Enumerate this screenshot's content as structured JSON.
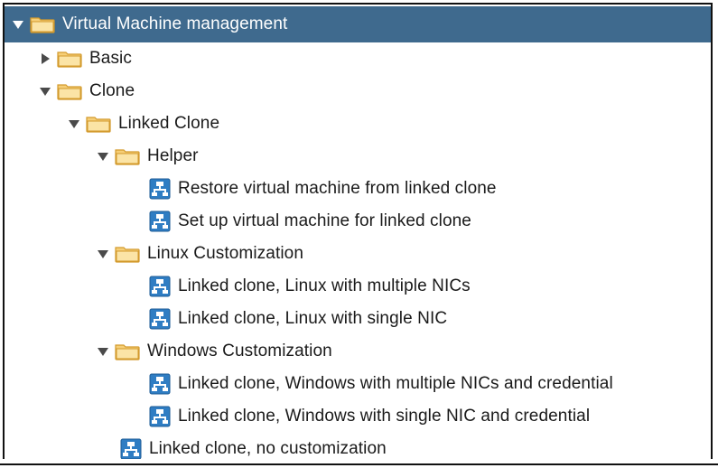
{
  "tree": {
    "root": {
      "label": "Virtual Machine management",
      "expanded": true
    },
    "basic": {
      "label": "Basic",
      "expanded": false
    },
    "clone": {
      "label": "Clone",
      "expanded": true
    },
    "linked_clone": {
      "label": "Linked Clone",
      "expanded": true
    },
    "helper": {
      "label": "Helper",
      "expanded": true
    },
    "restore": {
      "label": "Restore virtual machine from linked clone"
    },
    "setup": {
      "label": "Set up virtual machine for linked clone"
    },
    "linux_custom": {
      "label": "Linux Customization",
      "expanded": true
    },
    "linux_multi": {
      "label": "Linked clone, Linux with multiple NICs"
    },
    "linux_single": {
      "label": "Linked clone, Linux with single NIC"
    },
    "windows_custom": {
      "label": "Windows Customization",
      "expanded": true
    },
    "windows_multi": {
      "label": "Linked clone, Windows with multiple NICs and credential"
    },
    "windows_single": {
      "label": "Linked clone, Windows with single NIC and credential"
    },
    "no_custom": {
      "label": "Linked clone, no customization"
    }
  },
  "icons": {
    "folder": "folder-icon",
    "workflow": "workflow-icon",
    "expand": "caret-down-icon",
    "collapse": "caret-right-icon"
  },
  "colors": {
    "selection": "#3f6a8e",
    "folder_fill": "#f8d27a",
    "folder_edge": "#d49a2a",
    "workflow_blue": "#2f7dc3"
  }
}
